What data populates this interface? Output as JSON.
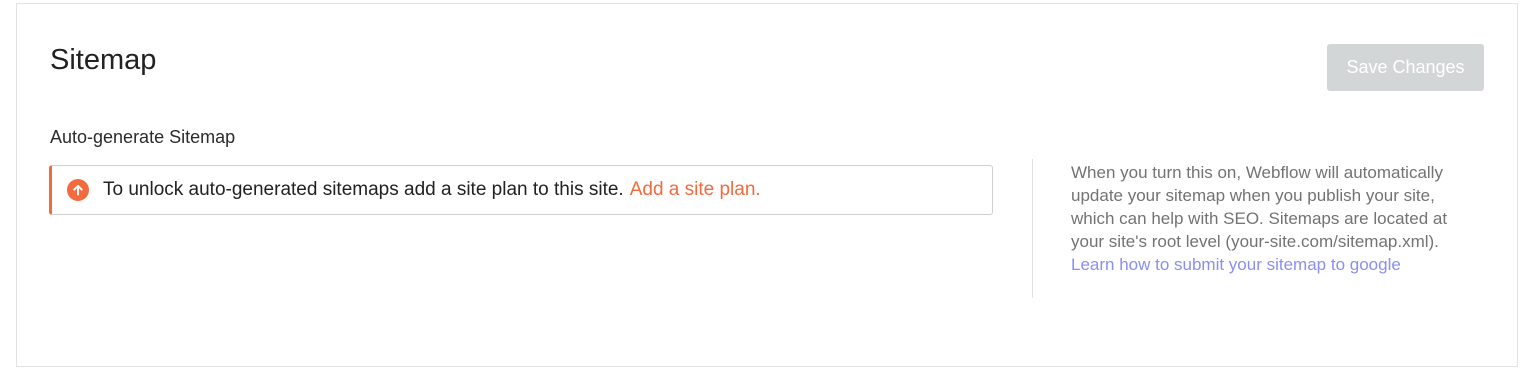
{
  "section": {
    "title": "Sitemap",
    "save_label": "Save Changes",
    "auto_label": "Auto-generate Sitemap"
  },
  "notice": {
    "text": "To unlock auto-generated sitemaps add a site plan to this site.",
    "link_text": "Add a site plan.",
    "icon": "arrow-up-circle-icon",
    "accent_color": "#f26a3d"
  },
  "help": {
    "text": "When you turn this on, Webflow will automatically update your sitemap when you publish your site, which can help with SEO. Sitemaps are located at your site's root level (your-site.com/sitemap.xml).",
    "link_text": "Learn how to submit your sitemap to google",
    "link_color": "#8a8ff0"
  },
  "colors": {
    "button_disabled_bg": "#d3d6d7"
  }
}
